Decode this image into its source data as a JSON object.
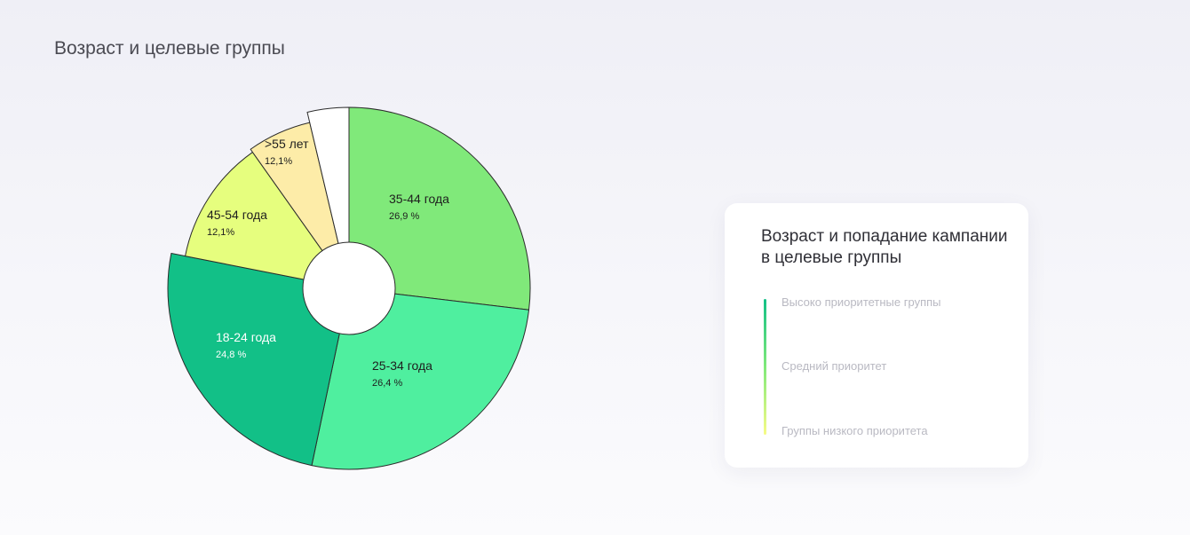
{
  "page": {
    "title": "Возраст и целевые группы"
  },
  "chart_data": {
    "type": "pie",
    "title": "",
    "slices": [
      {
        "label": "35-44 года",
        "pct_text": "26,9 %",
        "value": 26.9,
        "color": "#80e97a",
        "text_color": "#1e1e1e"
      },
      {
        "label": "25-34 года",
        "pct_text": "26,4 %",
        "value": 26.4,
        "color": "#4fef9f",
        "text_color": "#1e1e1e"
      },
      {
        "label": "18-24 года",
        "pct_text": "24,8 %",
        "value": 24.8,
        "color": "#12c087",
        "text_color": "#ffffff"
      },
      {
        "label": "45-54 года",
        "pct_text": "12,1%",
        "value": 12.1,
        "color": "#e6fe7e",
        "text_color": "#1e1e1e"
      },
      {
        "label": ">55 лет",
        "pct_text": "12,1%",
        "value": 6.1,
        "color": "#fdeca8",
        "text_color": "#1e1e1e"
      },
      {
        "label": "",
        "pct_text": "",
        "value": 3.7,
        "color": "#ffffff",
        "text_color": "#1e1e1e"
      }
    ],
    "stroke_color": "#2b2b2b"
  },
  "legend": {
    "title": "Возраст и попадание кампании в целевые группы",
    "items": [
      {
        "label": "Высоко приоритетные группы"
      },
      {
        "label": "Средний приоритет"
      },
      {
        "label": "Группы низкого приоритета"
      }
    ],
    "gradient_colors": [
      "#12c087",
      "#80e97a",
      "#f7fb86"
    ]
  }
}
